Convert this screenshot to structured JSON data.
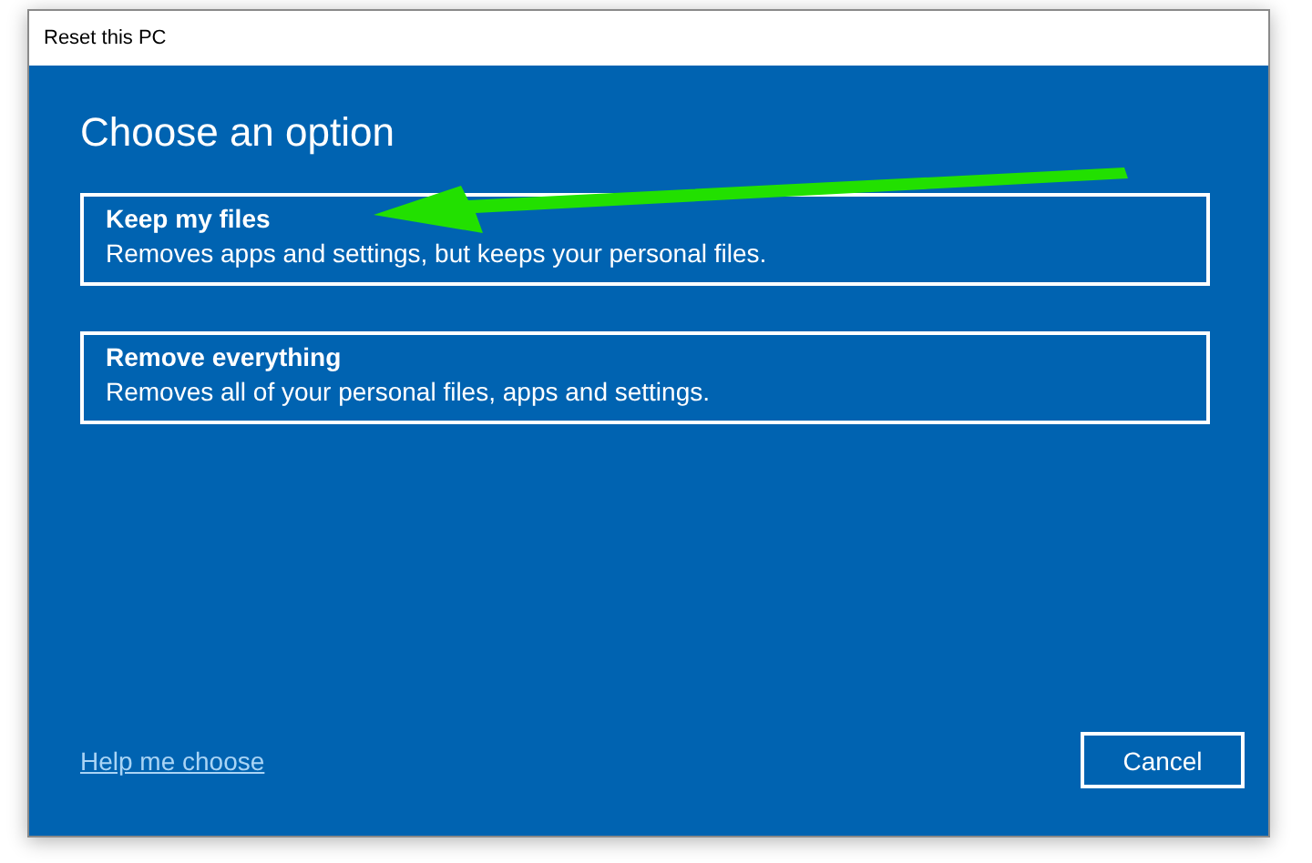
{
  "window": {
    "title": "Reset this PC"
  },
  "heading": "Choose an option",
  "options": [
    {
      "title": "Keep my files",
      "description": "Removes apps and settings, but keeps your personal files."
    },
    {
      "title": "Remove everything",
      "description": "Removes all of your personal files, apps and settings."
    }
  ],
  "help_link": "Help me choose",
  "buttons": [
    "Cancel"
  ]
}
